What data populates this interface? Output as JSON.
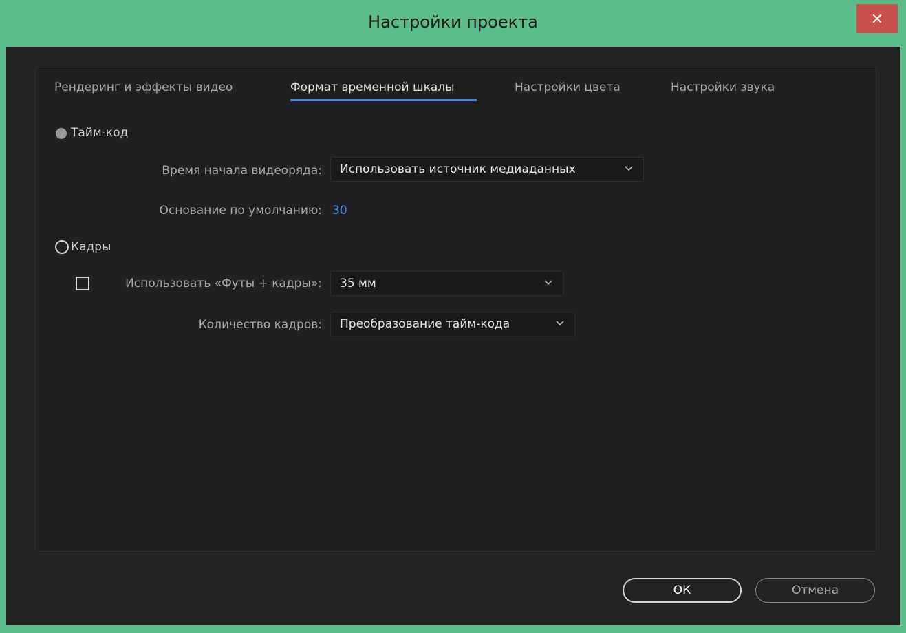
{
  "window": {
    "title": "Настройки проекта",
    "close_glyph": "✕"
  },
  "tabs": [
    {
      "label": "Рендеринг и эффекты видео"
    },
    {
      "label": "Формат временной шкалы"
    },
    {
      "label": "Настройки цвета"
    },
    {
      "label": "Настройки звука"
    }
  ],
  "active_tab": "Формат временной шкалы",
  "timecode": {
    "label": "Тайм-код",
    "selected": true,
    "start_time_label": "Время начала видеоряда:",
    "start_time_value": "Использовать источник медиаданных",
    "default_base_label": "Основание по умолчанию:",
    "default_base_value": "30"
  },
  "frames": {
    "label": "Кадры",
    "selected": false,
    "feet_frames_label": "Использовать «Футы + кадры»:",
    "feet_frames_checked": false,
    "feet_frames_value": "35 мм",
    "frame_count_label": "Количество кадров:",
    "frame_count_value": "Преобразование тайм-кода"
  },
  "buttons": {
    "ok": "ОК",
    "cancel": "Отмена"
  },
  "colors": {
    "accent": "#3f8ae0",
    "titlebar": "#5bbd8b",
    "close": "#c9504b",
    "background": "#232323"
  }
}
